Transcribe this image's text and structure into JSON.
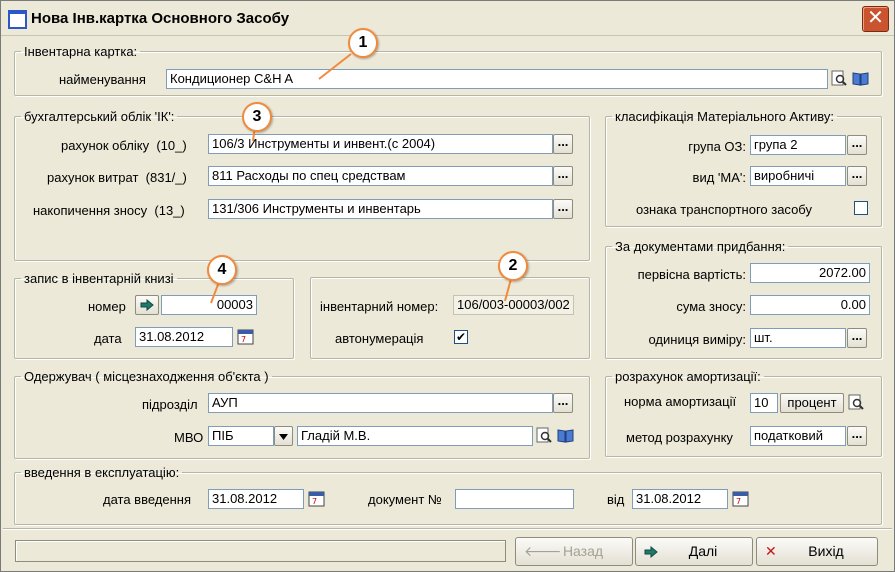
{
  "window": {
    "title": "Нова Інв.картка Основного Засобу",
    "close_glyph": "✕"
  },
  "inventory_card": {
    "legend": "Інвентарна картка:",
    "name_label": "найменування",
    "name_value": "Кондиционер C&H A"
  },
  "accounting": {
    "legend": "бухгалтерський облік 'ІК':",
    "account_label": "рахунок обліку",
    "account_code": "(10_)",
    "account_value": "106/3 Инструменты и инвент.(с 2004)",
    "expense_label": "рахунок витрат",
    "expense_code": "(831/_)",
    "expense_value": "811 Расходы по спец средствам",
    "depr_label": "накопичення зносу",
    "depr_code": "(13_)",
    "depr_value": "131/306 Инструменты и инвентарь",
    "dots": "..."
  },
  "classification": {
    "legend": "класифікація Матеріального Активу:",
    "group_label": "група ОЗ:",
    "group_value": "група 2",
    "type_label": "вид 'МА':",
    "type_value": "виробничі",
    "transport_label": "ознака транспортного засобу"
  },
  "register": {
    "legend": "запис в інвентарній книзі",
    "number_label": "номер",
    "number_value": "00003",
    "date_label": "дата",
    "date_value": "31.08.2012"
  },
  "inv_number": {
    "label": "інвентарний номер:",
    "value": "106/003-00003/002",
    "auto_label": "автонумерація",
    "auto_checked": "✔"
  },
  "acquisition": {
    "legend": "За документами придбання:",
    "initial_label": "первісна вартість:",
    "initial_value": "2072.00",
    "wear_label": "сума зносу:",
    "wear_value": "0.00",
    "unit_label": "одиниця виміру:",
    "unit_value": "шт."
  },
  "recipient": {
    "legend": "Одержувач ( місцезнаходження об'єкта )",
    "unit_label": "підрозділ",
    "unit_value": "АУП",
    "mvo_label": "МВО",
    "mvo_type": "ПІБ",
    "mvo_value": "Гладій М.В."
  },
  "amortization": {
    "legend": "розрахунок амортизації:",
    "norm_label": "норма амортизації",
    "norm_value": "10",
    "norm_button": "процент",
    "method_label": "метод розрахунку",
    "method_value": "податковий"
  },
  "commissioning": {
    "legend": "введення в експлуатацію:",
    "date_label": "дата введення",
    "date_value": "31.08.2012",
    "doc_label": "документ №",
    "doc_value": "",
    "from_label": "від",
    "from_value": "31.08.2012"
  },
  "callouts": [
    "1",
    "2",
    "3",
    "4"
  ],
  "footer": {
    "back": "Назад",
    "next": "Далі",
    "exit": "Вихід"
  },
  "colors": {
    "background": "#ece9d8",
    "callout_border": "#f08a3c",
    "input_border": "#7f9db9"
  }
}
